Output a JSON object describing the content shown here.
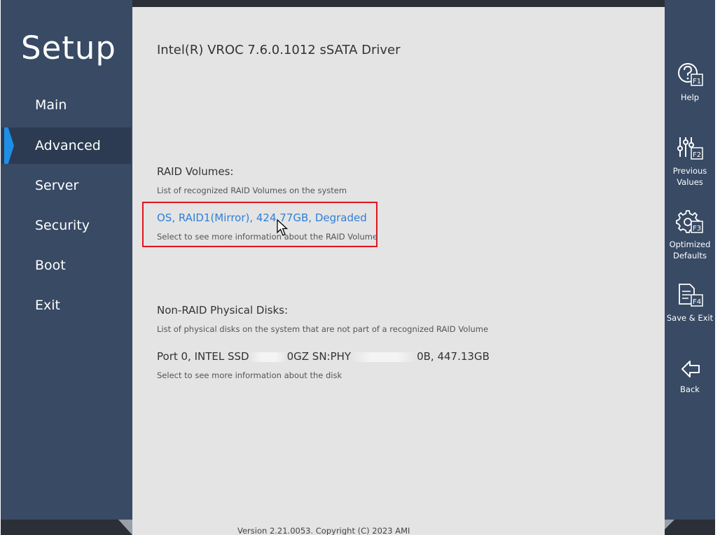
{
  "sidebar": {
    "title": "Setup",
    "items": [
      {
        "label": "Main"
      },
      {
        "label": "Advanced",
        "active": true
      },
      {
        "label": "Server"
      },
      {
        "label": "Security"
      },
      {
        "label": "Boot"
      },
      {
        "label": "Exit"
      }
    ]
  },
  "main": {
    "title": "Intel(R) VROC 7.6.0.1012 sSATA Driver",
    "raid_volumes": {
      "heading": "RAID Volumes:",
      "description": "List of recognized RAID Volumes on the system",
      "volume_label": "OS, RAID1(Mirror), 424.77GB, Degraded",
      "volume_help": "Select to see more information about the RAID Volume"
    },
    "non_raid": {
      "heading": "Non-RAID Physical Disks:",
      "description": "List of physical disks on the system that are not part of a recognized RAID Volume",
      "disk_part1": "Port 0, INTEL SSD",
      "disk_part2": "0GZ SN:PHY",
      "disk_part3": "0B, 447.13GB",
      "disk_help": "Select to see more information about the disk"
    },
    "footer": "Version 2.21.0053. Copyright (C) 2023 AMI"
  },
  "function_keys": [
    {
      "label": "Help",
      "key": "F1",
      "icon": "help-icon"
    },
    {
      "label": "Previous\nValues",
      "key": "F2",
      "icon": "sliders-icon"
    },
    {
      "label": "Optimized\nDefaults",
      "key": "F3",
      "icon": "gear-icon"
    },
    {
      "label": "Save & Exit",
      "key": "F4",
      "icon": "document-icon"
    },
    {
      "label": "Back",
      "key": "",
      "icon": "back-arrow-icon"
    }
  ],
  "colors": {
    "sidebar": "#384a64",
    "accent": "#1e8fe6",
    "link": "#2e7fd8",
    "highlight": "#e0141e",
    "content_bg": "#e4e4e4"
  }
}
